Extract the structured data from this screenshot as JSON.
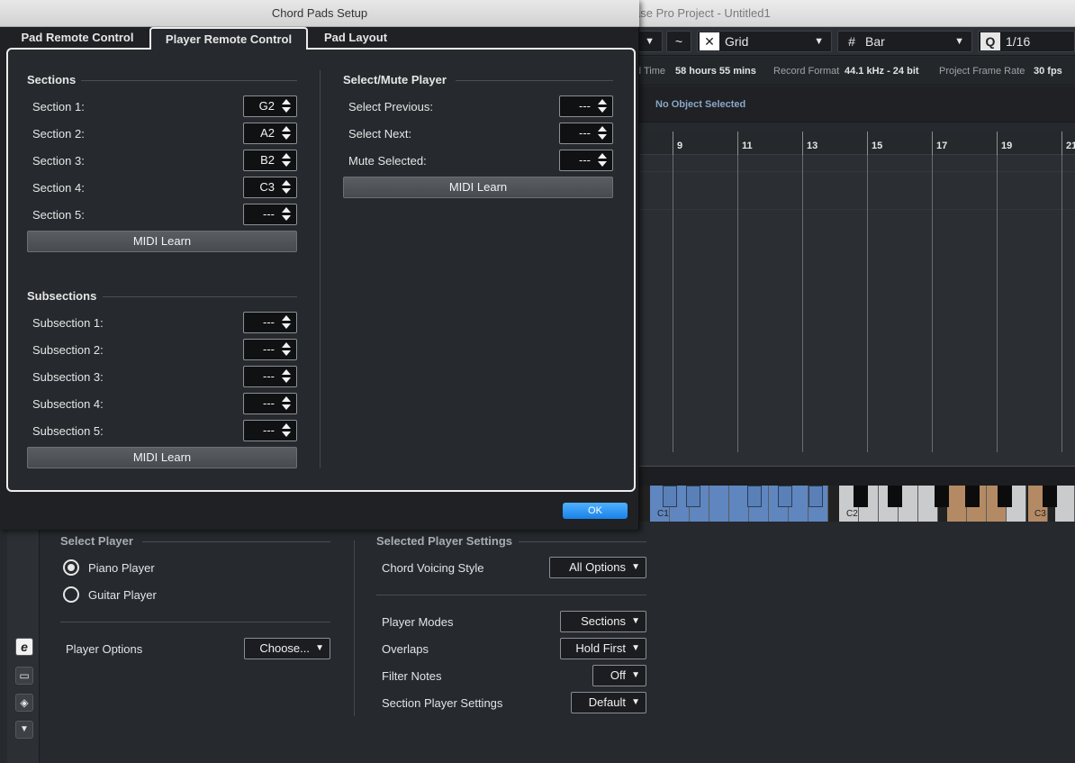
{
  "background_window": {
    "title": "ase Pro Project - Untitled1",
    "toolbar": {
      "snap_type": "Grid",
      "grid_type": "Bar",
      "quantize_value": "1/16",
      "quantize_icon_label": "Q"
    },
    "info_bar": {
      "time_label": "d Time",
      "time_value": "58 hours 55 mins",
      "record_format_label": "Record Format",
      "record_format_value": "44.1 kHz - 24 bit",
      "frame_rate_label": "Project Frame Rate",
      "frame_rate_value": "30 fps"
    },
    "infoline_text": "No Object Selected",
    "ruler_numbers": [
      "9",
      "11",
      "13",
      "15",
      "17",
      "19",
      "21"
    ],
    "keyboard_labels": [
      "C1",
      "C2",
      "C3"
    ],
    "lower_panel": {
      "select_player_title": "Select Player",
      "players": [
        {
          "label": "Piano Player",
          "selected": true
        },
        {
          "label": "Guitar Player",
          "selected": false
        }
      ],
      "player_options_label": "Player Options",
      "player_options_value": "Choose...",
      "selected_player_settings_title": "Selected Player Settings",
      "chord_voicing_label": "Chord Voicing Style",
      "chord_voicing_value": "All Options",
      "player_modes_label": "Player Modes",
      "player_modes_value": "Sections",
      "overlaps_label": "Overlaps",
      "overlaps_value": "Hold First",
      "filter_notes_label": "Filter Notes",
      "filter_notes_value": "Off",
      "section_player_settings_label": "Section Player Settings",
      "section_player_settings_value": "Default"
    }
  },
  "dialog": {
    "title": "Chord Pads Setup",
    "tabs": [
      {
        "label": "Pad Remote Control",
        "active": false
      },
      {
        "label": "Player Remote Control",
        "active": true
      },
      {
        "label": "Pad Layout",
        "active": false
      }
    ],
    "sections": {
      "title": "Sections",
      "rows": [
        {
          "label": "Section 1:",
          "value": "G2"
        },
        {
          "label": "Section 2:",
          "value": "A2"
        },
        {
          "label": "Section 3:",
          "value": "B2"
        },
        {
          "label": "Section 4:",
          "value": "C3"
        },
        {
          "label": "Section 5:",
          "value": "---"
        }
      ],
      "learn_label": "MIDI Learn"
    },
    "subsections": {
      "title": "Subsections",
      "rows": [
        {
          "label": "Subsection 1:",
          "value": "---"
        },
        {
          "label": "Subsection 2:",
          "value": "---"
        },
        {
          "label": "Subsection 3:",
          "value": "---"
        },
        {
          "label": "Subsection 4:",
          "value": "---"
        },
        {
          "label": "Subsection 5:",
          "value": "---"
        }
      ],
      "learn_label": "MIDI Learn"
    },
    "select_mute": {
      "title": "Select/Mute Player",
      "rows": [
        {
          "label": "Select Previous:",
          "value": "---"
        },
        {
          "label": "Select Next:",
          "value": "---"
        },
        {
          "label": "Mute Selected:",
          "value": "---"
        }
      ],
      "learn_label": "MIDI Learn"
    },
    "ok_label": "OK",
    "accent_color": "#1a82e8"
  }
}
